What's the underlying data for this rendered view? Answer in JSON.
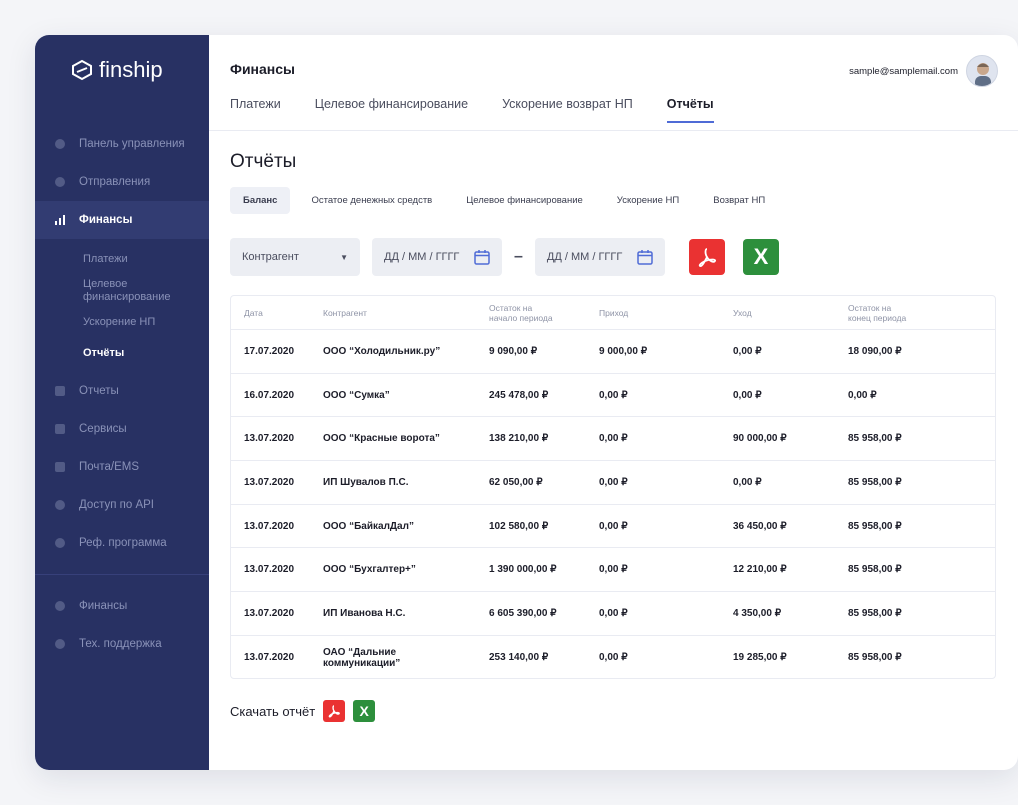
{
  "app": {
    "brand": "finship"
  },
  "sidebar": {
    "items": [
      {
        "label": "Панель управления",
        "icon": "dashboard-icon"
      },
      {
        "label": "Отправления",
        "icon": "shipments-icon"
      },
      {
        "label": "Финансы",
        "icon": "finance-chart-icon",
        "active": true
      }
    ],
    "sub_items": [
      "Платежи",
      "Целевое финансирование",
      "Ускорение НП",
      "Отчёты"
    ],
    "items_after": [
      {
        "label": "Отчеты",
        "icon": "reports-icon"
      },
      {
        "label": "Сервисы",
        "icon": "services-icon"
      },
      {
        "label": "Почта/EMS",
        "icon": "mail-icon"
      },
      {
        "label": "Доступ по API",
        "icon": "api-icon"
      },
      {
        "label": "Реф. программа",
        "icon": "referral-icon"
      }
    ],
    "items_bottom": [
      {
        "label": "Финансы",
        "icon": "settings-icon"
      },
      {
        "label": "Тех. поддержка",
        "icon": "support-icon"
      }
    ]
  },
  "header": {
    "title": "Финансы",
    "user_email": "sample@samplemail.com",
    "tabs": [
      "Платежи",
      "Целевое финансирование",
      "Ускорение возврат НП",
      "Отчёты"
    ]
  },
  "reports": {
    "title": "Отчёты",
    "sub_tabs": [
      "Баланс",
      "Остатое денежных средств",
      "Целевое финансирование",
      "Ускорение НП",
      "Возврат НП"
    ],
    "filters": {
      "counterparty": "Контрагент",
      "date_from": "ДД / ММ / ГГГГ",
      "date_to": "ДД / ММ / ГГГГ"
    },
    "xls_label": "X",
    "columns": [
      "Дата",
      "Контрагент",
      "Остаток на начало периода",
      "Приход",
      "Уход",
      "Остаток на конец периода"
    ],
    "rows": [
      [
        "17.07.2020",
        "ООО “Холодильник.ру”",
        "9 090,00 ₽",
        "9 000,00 ₽",
        "0,00 ₽",
        "18 090,00 ₽"
      ],
      [
        "16.07.2020",
        "ООО “Сумка”",
        "245 478,00 ₽",
        "0,00 ₽",
        "0,00 ₽",
        "0,00 ₽"
      ],
      [
        "13.07.2020",
        "ООО “Красные ворота”",
        "138 210,00 ₽",
        "0,00 ₽",
        "90 000,00 ₽",
        "85 958,00 ₽"
      ],
      [
        "13.07.2020",
        "ИП Шувалов П.С.",
        "62 050,00 ₽",
        "0,00 ₽",
        "0,00 ₽",
        "85 958,00 ₽"
      ],
      [
        "13.07.2020",
        "ООО “БайкалДал”",
        "102 580,00 ₽",
        "0,00 ₽",
        "36 450,00 ₽",
        "85 958,00 ₽"
      ],
      [
        "13.07.2020",
        "ООО “Бухгалтер+”",
        "1 390 000,00 ₽",
        "0,00 ₽",
        "12 210,00 ₽",
        "85 958,00 ₽"
      ],
      [
        "13.07.2020",
        "ИП Иванова Н.С.",
        "6 605 390,00 ₽",
        "0,00 ₽",
        "4 350,00 ₽",
        "85 958,00 ₽"
      ],
      [
        "13.07.2020",
        "ОАО “Дальние коммуникации”",
        "253 140,00 ₽",
        "0,00 ₽",
        "19 285,00 ₽",
        "85 958,00 ₽"
      ]
    ],
    "download_label": "Скачать отчёт"
  },
  "colors": {
    "sidebar": "#283163",
    "pdf": "#ea3232",
    "excel": "#2d8f3c",
    "accent": "#4f6bd6"
  }
}
